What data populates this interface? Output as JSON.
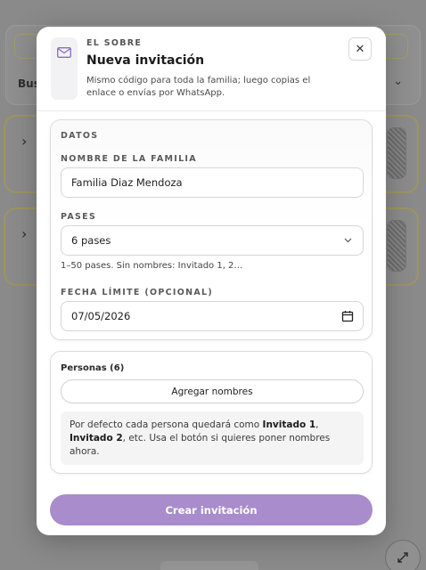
{
  "background": {
    "search_label_partial": "Bus",
    "chevron_right": "›",
    "chevron_down": "⌄"
  },
  "modal": {
    "eyebrow": "EL SOBRE",
    "title": "Nueva invitación",
    "subtitle": "Mismo código para toda la familia; luego copias el enlace o envías por WhatsApp.",
    "close_label": "✕"
  },
  "datos": {
    "section_label": "DATOS",
    "family_name_label": "NOMBRE DE LA FAMILIA",
    "family_name_value": "Familia Diaz Mendoza",
    "passes_label": "PASES",
    "passes_value": "6 pases",
    "passes_hint": "1–50 pases. Sin nombres: Invitado 1, 2…",
    "deadline_label": "FECHA LÍMITE (OPCIONAL)",
    "deadline_value": "07/05/2026"
  },
  "personas": {
    "label": "Personas (6)",
    "add_names_button": "Agregar nombres",
    "note_prefix": "Por defecto cada persona quedará como ",
    "note_bold1": "Invitado 1",
    "note_mid": ", ",
    "note_bold2": "Invitado 2",
    "note_suffix": ", etc. Usa el botón si quieres poner nombres ahora."
  },
  "footer": {
    "create_button": "Crear invitación"
  },
  "colors": {
    "accent": "#a98ccb",
    "envelope_icon": "#8c6cc0"
  },
  "icons": {
    "envelope": "envelope-icon",
    "close": "close-icon",
    "select_chevron": "chevron-down-icon",
    "calendar": "calendar-icon",
    "expand": "expand-icon"
  }
}
